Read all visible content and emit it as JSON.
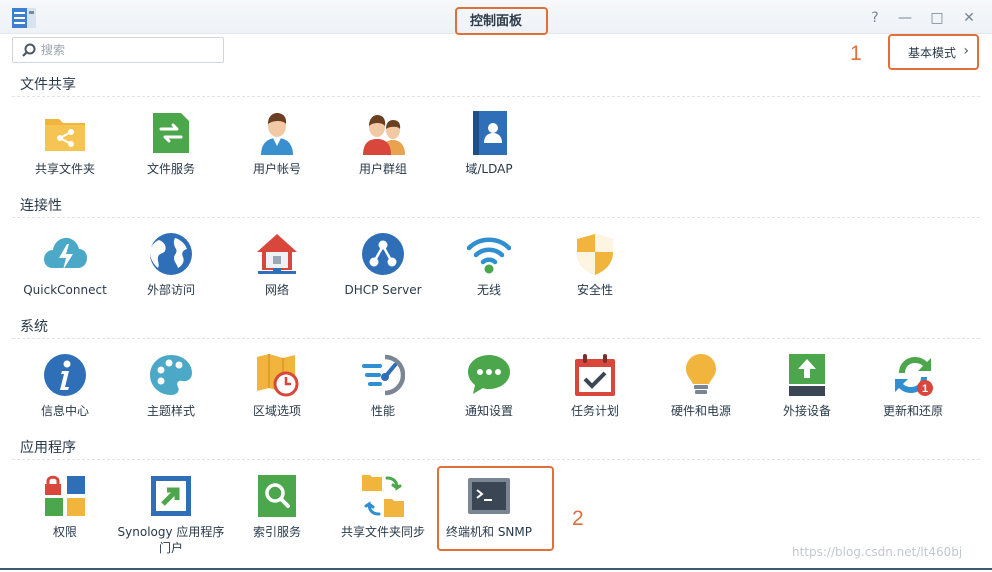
{
  "window": {
    "title": "控制面板",
    "help": "?",
    "minimize": "—",
    "maximize": "□",
    "close": "✕"
  },
  "search": {
    "placeholder": "搜索"
  },
  "annotations": {
    "one": "1",
    "two": "2"
  },
  "mode_button": {
    "label": "基本模式",
    "chevron": "›"
  },
  "sections": [
    {
      "title": "文件共享",
      "items": [
        {
          "label": "共享文件夹",
          "icon": "shared-folder-icon"
        },
        {
          "label": "文件服务",
          "icon": "file-services-icon"
        },
        {
          "label": "用户帐号",
          "icon": "user-icon"
        },
        {
          "label": "用户群组",
          "icon": "group-icon"
        },
        {
          "label": "域/LDAP",
          "icon": "ldap-book-icon"
        }
      ]
    },
    {
      "title": "连接性",
      "items": [
        {
          "label": "QuickConnect",
          "icon": "cloud-bolt-icon"
        },
        {
          "label": "外部访问",
          "icon": "globe-icon"
        },
        {
          "label": "网络",
          "icon": "home-network-icon"
        },
        {
          "label": "DHCP Server",
          "icon": "dhcp-icon"
        },
        {
          "label": "无线",
          "icon": "wifi-icon"
        },
        {
          "label": "安全性",
          "icon": "shield-icon"
        }
      ]
    },
    {
      "title": "系统",
      "items": [
        {
          "label": "信息中心",
          "icon": "info-icon"
        },
        {
          "label": "主题样式",
          "icon": "palette-icon"
        },
        {
          "label": "区域选项",
          "icon": "map-clock-icon"
        },
        {
          "label": "性能",
          "icon": "gauge-icon"
        },
        {
          "label": "通知设置",
          "icon": "chat-bubble-icon"
        },
        {
          "label": "任务计划",
          "icon": "calendar-check-icon"
        },
        {
          "label": "硬件和电源",
          "icon": "bulb-icon"
        },
        {
          "label": "外接设备",
          "icon": "upload-icon"
        },
        {
          "label": "更新和还原",
          "icon": "refresh-icon",
          "badge": "1"
        }
      ]
    },
    {
      "title": "应用程序",
      "items": [
        {
          "label": "权限",
          "icon": "privileges-icon"
        },
        {
          "label": "Synology 应用程序门户",
          "icon": "app-portal-icon"
        },
        {
          "label": "索引服务",
          "icon": "index-search-icon"
        },
        {
          "label": "共享文件夹同步",
          "icon": "folder-sync-icon"
        },
        {
          "label": "终端机和 SNMP",
          "icon": "terminal-icon"
        }
      ]
    }
  ],
  "watermark": "https://blog.csdn.net/lt460bj"
}
